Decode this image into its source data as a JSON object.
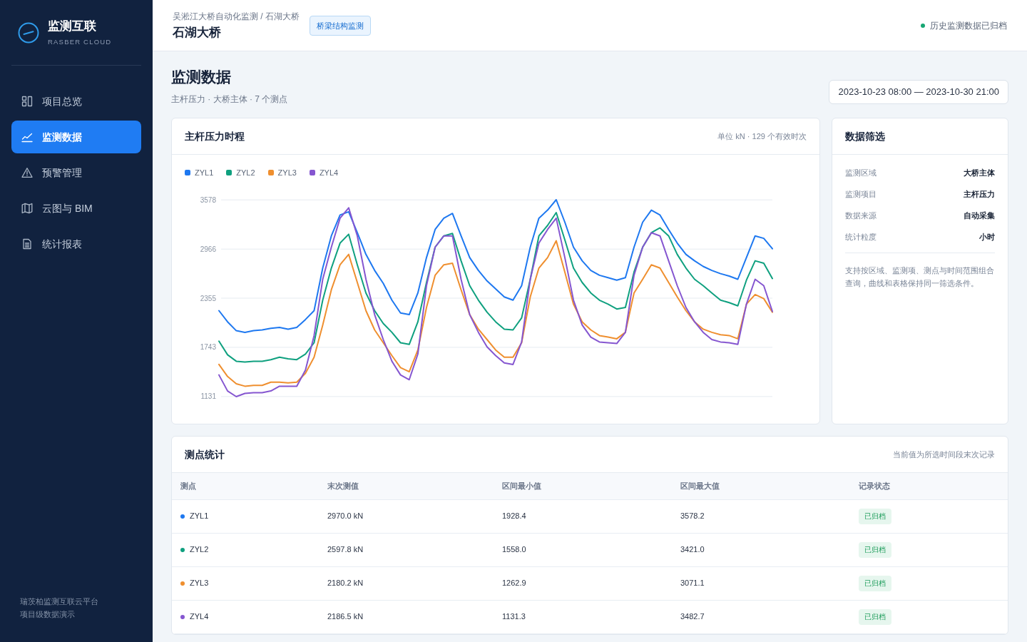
{
  "sidebar": {
    "brand": {
      "title": "监测互联",
      "subtitle": "RASBER CLOUD"
    },
    "items": [
      {
        "label": "项目总览",
        "selected": false
      },
      {
        "label": "监测数据",
        "selected": true
      },
      {
        "label": "预警管理",
        "selected": false
      },
      {
        "label": "云图与 BIM",
        "selected": false
      },
      {
        "label": "统计报表",
        "selected": false
      }
    ],
    "footer": [
      "瑞茨柏监测互联云平台",
      "项目级数据演示"
    ]
  },
  "header": {
    "breadcrumb": "吴淞江大桥自动化监测 / 石湖大桥",
    "title": "石湖大桥",
    "badge": "桥梁结构监测",
    "status": "历史监测数据已归档"
  },
  "page": {
    "title": "监测数据",
    "subtitle": "主杆压力 · 大桥主体 · 7 个测点",
    "date_range": "2023-10-23 08:00 — 2023-10-30 21:00"
  },
  "chart_card": {
    "title": "主杆压力时程",
    "meta": "单位 kN · 129 个有效时次",
    "chart_data": {
      "type": "line",
      "grid": true,
      "ylim": [
        1130,
        3580
      ],
      "yticks": [
        1131,
        1743,
        2355,
        2966,
        3578
      ],
      "series": [
        {
          "name": "ZYL1",
          "color": "#1e78f0",
          "values": [
            2200,
            2060,
            1950,
            1930,
            1950,
            1960,
            1980,
            1990,
            1970,
            1990,
            2090,
            2200,
            2730,
            3130,
            3390,
            3430,
            3170,
            2900,
            2700,
            2540,
            2330,
            2170,
            2150,
            2420,
            2860,
            3210,
            3350,
            3410,
            3130,
            2860,
            2700,
            2570,
            2470,
            2370,
            2330,
            2510,
            2990,
            3350,
            3450,
            3580,
            3300,
            2990,
            2820,
            2700,
            2640,
            2610,
            2580,
            2610,
            2990,
            3300,
            3450,
            3390,
            3210,
            3040,
            2900,
            2820,
            2750,
            2700,
            2660,
            2630,
            2590,
            2860,
            3130,
            3100,
            2970
          ]
        },
        {
          "name": "ZYL2",
          "color": "#0fa07f",
          "values": [
            1820,
            1650,
            1570,
            1560,
            1570,
            1570,
            1590,
            1620,
            1600,
            1590,
            1660,
            1800,
            2330,
            2730,
            3040,
            3150,
            2770,
            2420,
            2200,
            2040,
            1930,
            1800,
            1780,
            2060,
            2550,
            2990,
            3130,
            3160,
            2820,
            2510,
            2330,
            2180,
            2060,
            1970,
            1960,
            2110,
            2590,
            3130,
            3260,
            3420,
            3080,
            2730,
            2550,
            2420,
            2330,
            2280,
            2220,
            2240,
            2680,
            2990,
            3170,
            3230,
            3130,
            2900,
            2730,
            2590,
            2510,
            2420,
            2330,
            2300,
            2260,
            2580,
            2820,
            2790,
            2600
          ]
        },
        {
          "name": "ZYL3",
          "color": "#ef8f2f",
          "values": [
            1530,
            1380,
            1290,
            1260,
            1270,
            1270,
            1310,
            1310,
            1300,
            1310,
            1420,
            1620,
            2020,
            2460,
            2770,
            2900,
            2550,
            2200,
            1960,
            1800,
            1640,
            1490,
            1440,
            1710,
            2240,
            2640,
            2770,
            2790,
            2460,
            2150,
            1970,
            1840,
            1710,
            1620,
            1620,
            1800,
            2370,
            2730,
            2860,
            3070,
            2680,
            2280,
            2060,
            1960,
            1890,
            1870,
            1850,
            1930,
            2420,
            2590,
            2770,
            2730,
            2550,
            2370,
            2200,
            2060,
            1970,
            1930,
            1900,
            1890,
            1850,
            2280,
            2400,
            2350,
            2180
          ]
        },
        {
          "name": "ZYL4",
          "color": "#8556d0",
          "values": [
            1400,
            1200,
            1130,
            1170,
            1180,
            1180,
            1200,
            1260,
            1260,
            1260,
            1460,
            1890,
            2590,
            2990,
            3350,
            3480,
            3130,
            2590,
            2150,
            1840,
            1570,
            1400,
            1340,
            1660,
            2510,
            2990,
            3130,
            3130,
            2590,
            2150,
            1930,
            1750,
            1640,
            1550,
            1530,
            1810,
            2590,
            3040,
            3210,
            3350,
            2860,
            2330,
            2020,
            1870,
            1810,
            1800,
            1790,
            1930,
            2640,
            2990,
            3170,
            3130,
            2820,
            2510,
            2240,
            2060,
            1930,
            1840,
            1810,
            1800,
            1780,
            2280,
            2590,
            2510,
            2190
          ]
        }
      ]
    }
  },
  "filter_card": {
    "title": "数据筛选",
    "fields": [
      {
        "label": "监测区域",
        "value": "大桥主体"
      },
      {
        "label": "监测项目",
        "value": "主杆压力"
      },
      {
        "label": "数据来源",
        "value": "自动采集"
      },
      {
        "label": "统计粒度",
        "value": "小时"
      }
    ],
    "note": "支持按区域、监测项、测点与时间范围组合查询，曲线和表格保持同一筛选条件。"
  },
  "table_card": {
    "title": "测点统计",
    "note": "当前值为所选时间段末次记录",
    "columns": [
      "测点",
      "末次测值",
      "区间最小值",
      "区间最大值",
      "记录状态"
    ],
    "rows": [
      {
        "point": "ZYL1",
        "color": "#1e78f0",
        "last": "2970.0 kN",
        "min": "1928.4",
        "max": "3578.2",
        "status": "已归档"
      },
      {
        "point": "ZYL2",
        "color": "#0fa07f",
        "last": "2597.8 kN",
        "min": "1558.0",
        "max": "3421.0",
        "status": "已归档"
      },
      {
        "point": "ZYL3",
        "color": "#ef8f2f",
        "last": "2180.2 kN",
        "min": "1262.9",
        "max": "3071.1",
        "status": "已归档"
      },
      {
        "point": "ZYL4",
        "color": "#8556d0",
        "last": "2186.5 kN",
        "min": "1131.3",
        "max": "3482.7",
        "status": "已归档"
      }
    ]
  }
}
